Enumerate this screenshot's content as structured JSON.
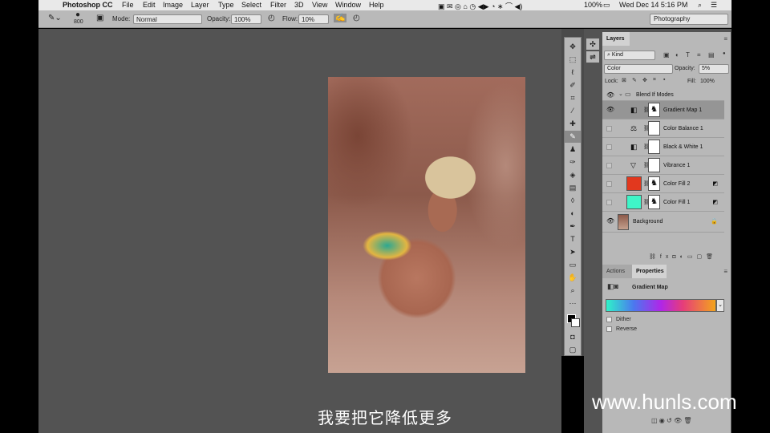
{
  "menubar": {
    "app_name": "Photoshop CC",
    "menus": [
      "File",
      "Edit",
      "Image",
      "Layer",
      "Type",
      "Select",
      "Filter",
      "3D",
      "View",
      "Window",
      "Help"
    ],
    "battery": "100%",
    "datetime": "Wed Dec 14  5:16 PM"
  },
  "options_bar": {
    "brush_size": "800",
    "mode_label": "Mode:",
    "mode_value": "Normal",
    "opacity_label": "Opacity:",
    "opacity_value": "100%",
    "flow_label": "Flow:",
    "flow_value": "10%",
    "workspace": "Photography"
  },
  "layers_panel": {
    "tab": "Layers",
    "filter_kind": "Kind",
    "blend_mode": "Color",
    "opacity_label": "Opacity:",
    "opacity_value": "5%",
    "lock_label": "Lock:",
    "fill_label": "Fill:",
    "fill_value": "100%",
    "group_name": "Blend If Modes",
    "layers": [
      {
        "name": "Gradient Map 1",
        "visible": true,
        "selected": true
      },
      {
        "name": "Color Balance 1",
        "visible": false
      },
      {
        "name": "Black & White 1",
        "visible": false
      },
      {
        "name": "Vibrance 1",
        "visible": false
      },
      {
        "name": "Color Fill 2",
        "visible": false,
        "color": "#e2381e"
      },
      {
        "name": "Color Fill 1",
        "visible": false,
        "color": "#3ff5c8"
      },
      {
        "name": "Background",
        "visible": true
      }
    ]
  },
  "properties_panel": {
    "tabs": [
      "Actions",
      "Properties"
    ],
    "title": "Gradient Map",
    "dither_label": "Dither",
    "reverse_label": "Reverse"
  },
  "subtitle": "我要把它降低更多",
  "watermark": "www.hunls.com"
}
